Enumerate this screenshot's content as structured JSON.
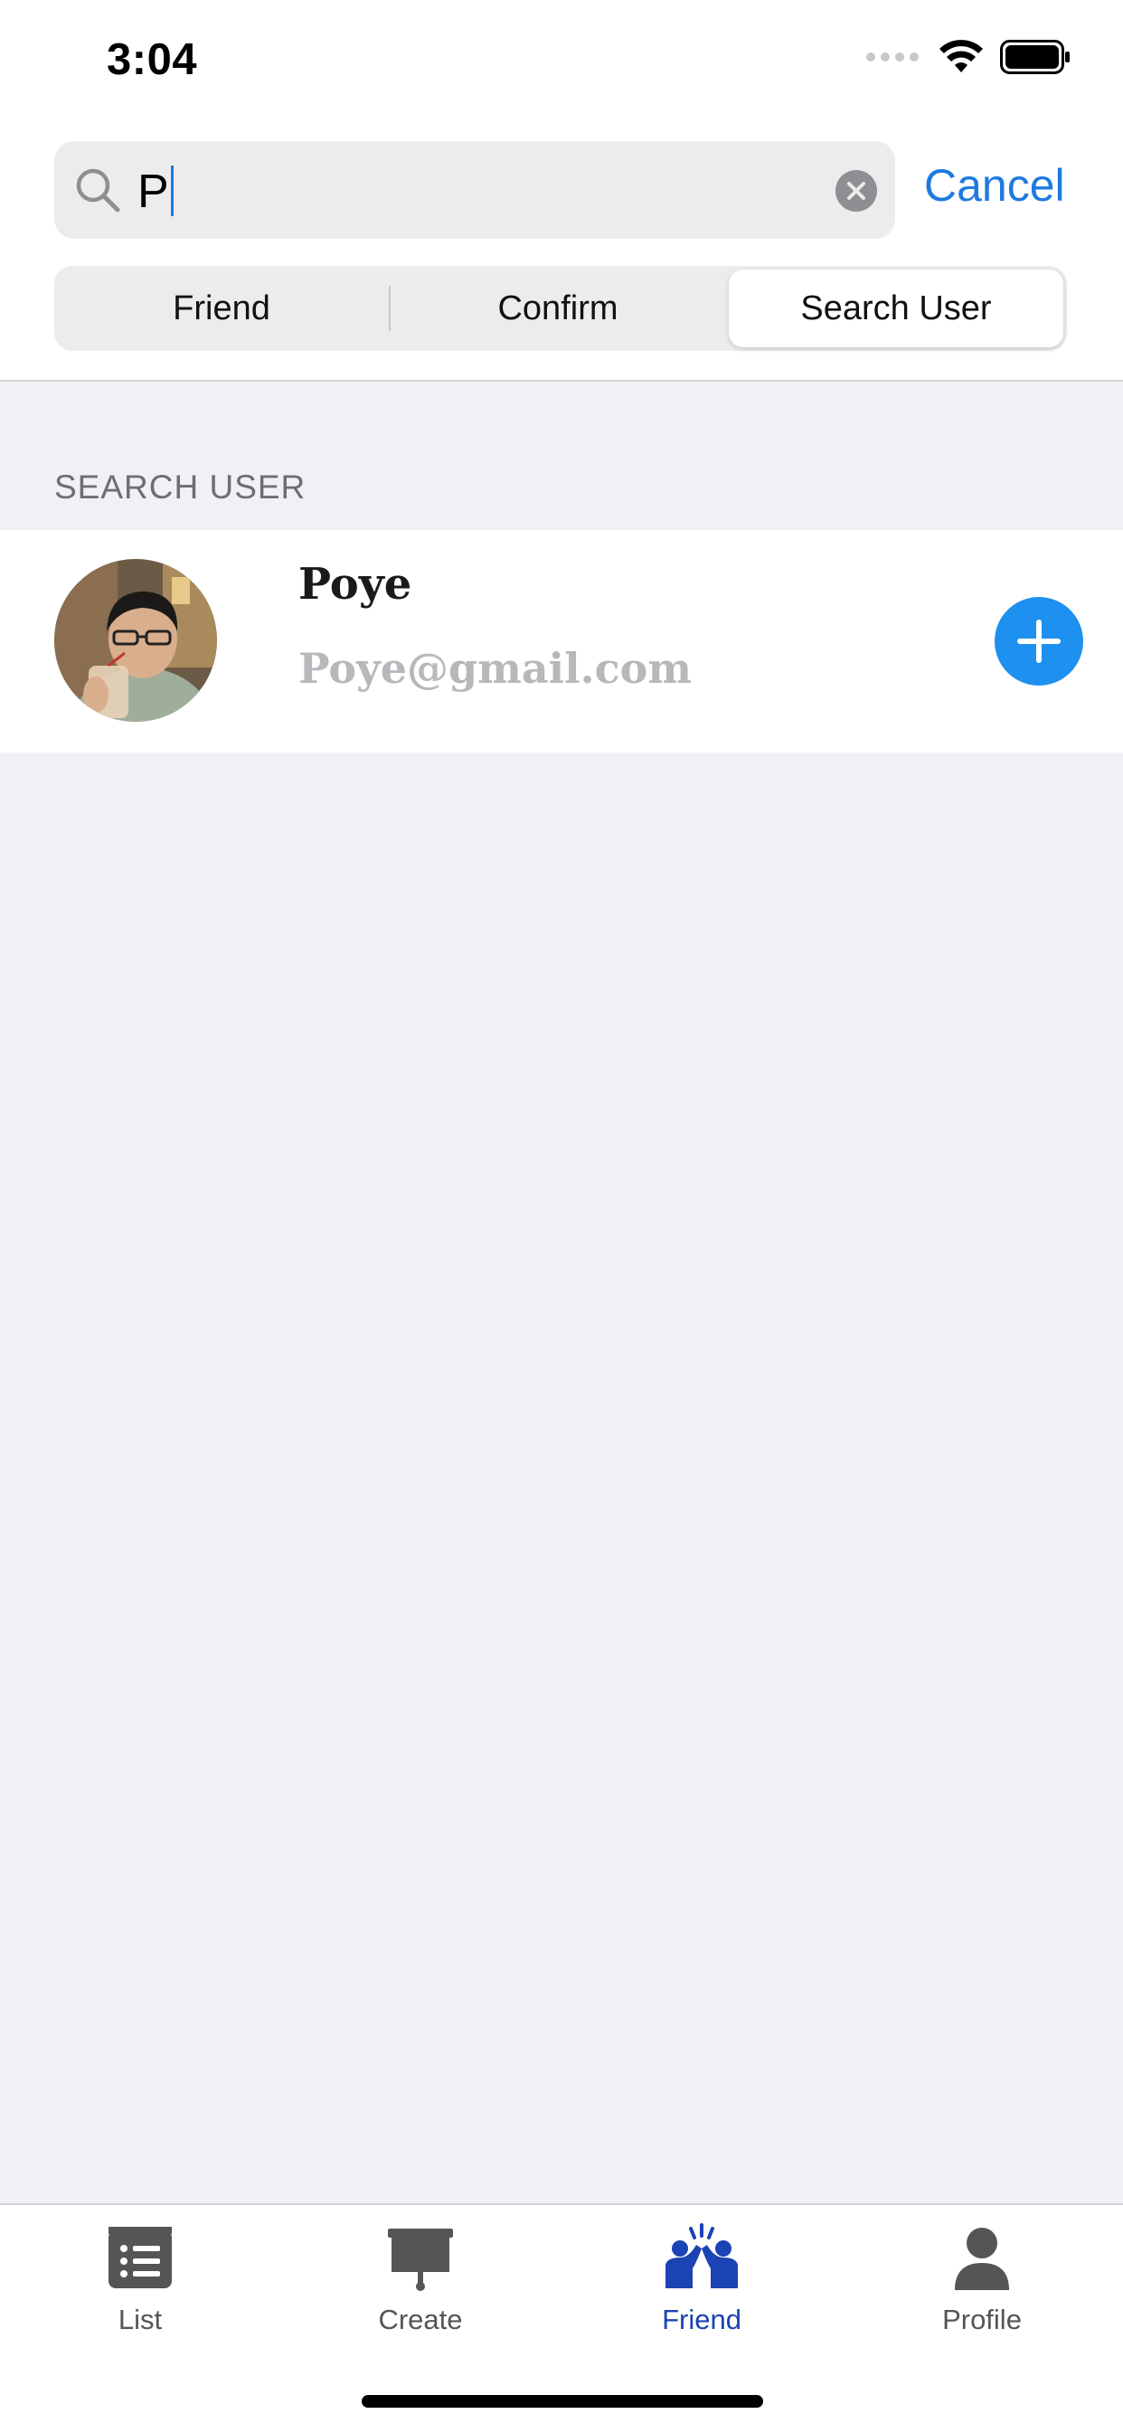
{
  "status_bar": {
    "time": "3:04"
  },
  "search": {
    "value": "P",
    "cancel_label": "Cancel"
  },
  "segments": [
    {
      "label": "Friend"
    },
    {
      "label": "Confirm"
    },
    {
      "label": "Search User"
    }
  ],
  "selected_segment": "Search User",
  "section": {
    "title": "SEARCH USER"
  },
  "results": [
    {
      "name": "Poye",
      "email": "Poye@gmail.com"
    }
  ],
  "tabs": [
    {
      "label": "List",
      "icon": "list-icon"
    },
    {
      "label": "Create",
      "icon": "easel-icon"
    },
    {
      "label": "Friend",
      "icon": "friends-icon"
    },
    {
      "label": "Profile",
      "icon": "person-icon"
    }
  ],
  "active_tab": "Friend",
  "colors": {
    "accent": "#1f7ae0",
    "add_button": "#1e90f0",
    "active_tab": "#1c43b4",
    "background": "#f0f0f5"
  }
}
